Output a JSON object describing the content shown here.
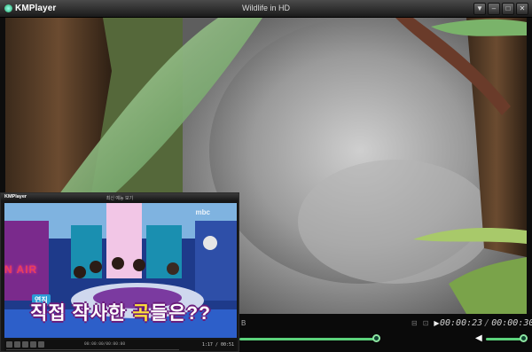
{
  "app": {
    "name": "KMPlayer",
    "window_title": "Wildlife in HD"
  },
  "window_buttons": [
    "▼",
    "–",
    "□",
    "✕"
  ],
  "player": {
    "time_current": "00:00:23",
    "time_total": "00:00:30",
    "time_separator": "/",
    "status_tag": "B",
    "seek_progress": 0.47,
    "volume_level": 0.9,
    "accent_color": "#5cd27c"
  },
  "mini_player": {
    "logo": "KMPlayer",
    "title": "최신 예능 보기",
    "caption_prefix": "직접 작사한 ",
    "caption_highlight": "곡",
    "caption_suffix": "들은??",
    "side_tag": "연직",
    "sign_text": "N AIR",
    "channel_logo": "mbc",
    "info_text": "00:00:00/00:00:00",
    "time_readout": "1:17 / 00:51",
    "seek_progress": 0.74
  },
  "icons": {
    "app_logo": "km-logo-icon",
    "play": "play-icon",
    "volume": "speaker-icon"
  }
}
